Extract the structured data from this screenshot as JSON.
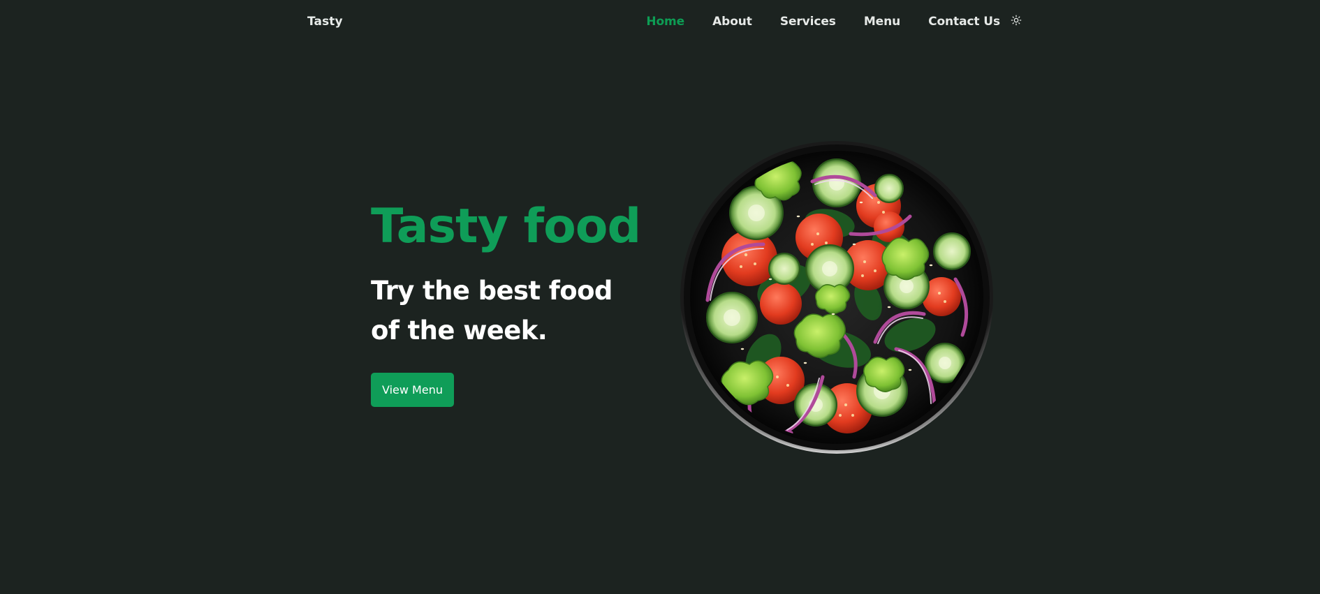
{
  "header": {
    "logo": "Tasty",
    "nav": [
      {
        "label": "Home",
        "active": true
      },
      {
        "label": "About",
        "active": false
      },
      {
        "label": "Services",
        "active": false
      },
      {
        "label": "Menu",
        "active": false
      },
      {
        "label": "Contact Us",
        "active": false
      }
    ],
    "theme_toggle_icon": "sun-icon"
  },
  "hero": {
    "title": "Tasty food",
    "subtitle": "Try the best food of the week.",
    "button_label": "View Menu",
    "image": "salad-bowl"
  },
  "colors": {
    "background": "#1c2320",
    "accent": "#0f9d58",
    "text": "#ffffff"
  }
}
